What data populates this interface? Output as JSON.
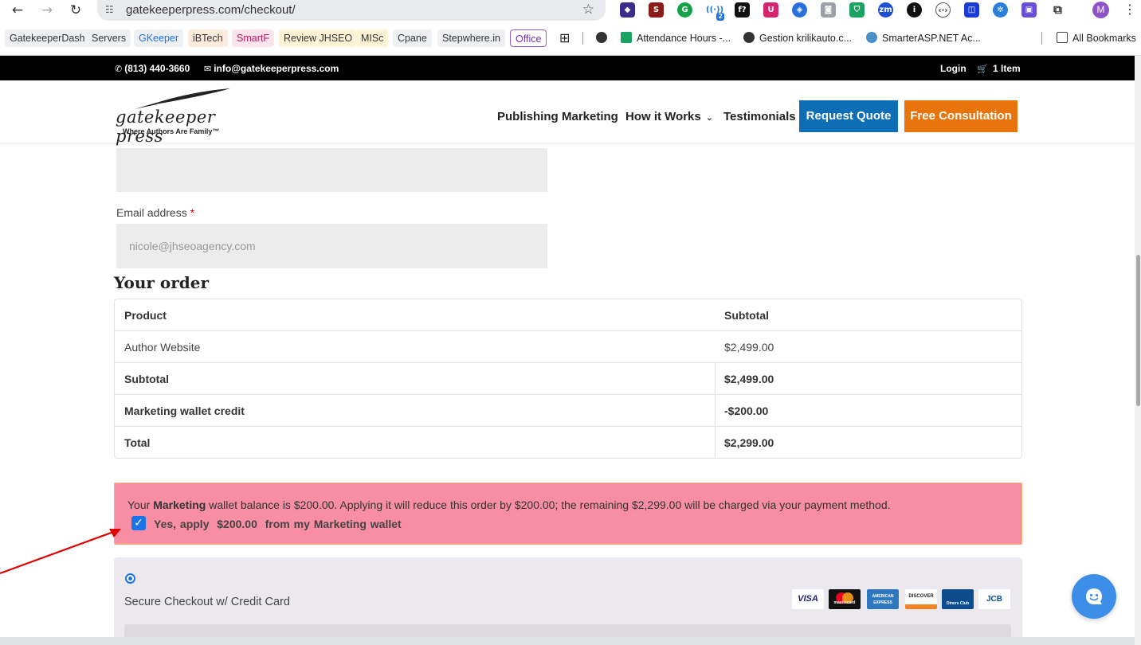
{
  "browser": {
    "url": "gatekeeperpress.com/checkout/",
    "avatar_letter": "M",
    "bookmarks_chips": [
      "GatekeeperDash",
      "Servers",
      "GKeeper",
      "iBTech",
      "SmartF",
      "Review JHSEO",
      "MISc",
      "Cpane",
      "Stepwhere.in",
      "Office"
    ],
    "bookmarks_links": [
      "Attendance Hours -...",
      "Gestion krilikauto.c...",
      "SmarterASP.NET Ac...",
      "All Bookmarks"
    ],
    "ext_badge": "2"
  },
  "topbar": {
    "phone": "(813) 440-3660",
    "email": "info@gatekeeperpress.com",
    "login": "Login",
    "cart": "1 Item"
  },
  "header": {
    "logo_text": "gatekeeper press",
    "logo_tagline": "Where Authors Are Family™",
    "nav": [
      "Publishing",
      "Marketing",
      "How it Works",
      "Testimonials"
    ],
    "request_quote": "Request Quote",
    "free_consultation": "Free Consultation"
  },
  "form": {
    "email_label": "Email address",
    "required_mark": "*",
    "email_value": "nicole@jhseoagency.com"
  },
  "order": {
    "title": "Your order",
    "headers": [
      "Product",
      "Subtotal"
    ],
    "rows": [
      {
        "label": "Author Website",
        "value": "$2,499.00"
      },
      {
        "label": "Subtotal",
        "value": "$2,499.00"
      },
      {
        "label": "Marketing wallet credit",
        "value": "-$200.00"
      },
      {
        "label": "Total",
        "value": "$2,299.00"
      }
    ]
  },
  "wallet": {
    "msg_prefix": "Your ",
    "msg_bold": "Marketing",
    "msg_rest": " wallet balance is $200.00. Applying it will reduce this order by $200.00; the remaining $2,299.00 will be charged via your payment method.",
    "checkbox_label": "Yes, apply  $200.00  from my Marketing wallet",
    "checked": true
  },
  "payment": {
    "label": "Secure Checkout w/ Credit Card",
    "cards": [
      "VISA",
      "mastercard",
      "AMERICAN EXPRESS",
      "DISCOVER",
      "Diners Club",
      "JCB"
    ]
  },
  "colors": {
    "brand_blue": "#0d6db5",
    "brand_orange": "#e8750b",
    "wallet_bg": "#f78ea4",
    "chat_blue": "#3d8ee8"
  }
}
